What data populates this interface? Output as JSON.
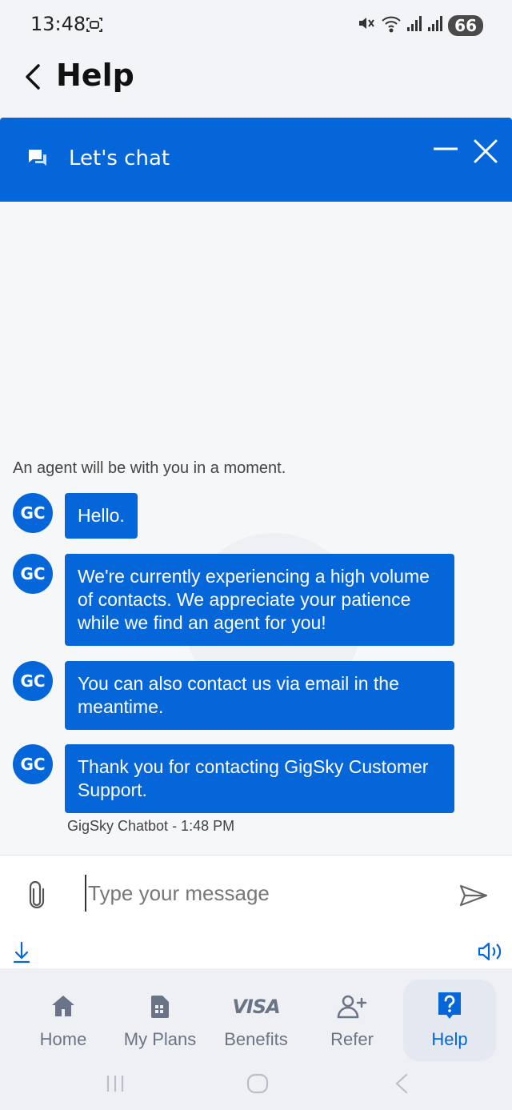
{
  "status_bar": {
    "time": "13:48",
    "battery": "66",
    "icons": [
      "screenshot-icon",
      "mute-icon",
      "wifi-icon",
      "signal-icon",
      "signal-icon"
    ]
  },
  "header": {
    "title": "Help",
    "back_icon": "chevron-left-icon"
  },
  "chat_widget": {
    "title": "Let's chat",
    "icons": [
      "chat-bubbles-icon",
      "minimize-icon",
      "close-icon"
    ],
    "accent_color": "#0466d9",
    "agent_note": "An agent will be with you in a moment.",
    "messages": [
      {
        "avatar": "GC",
        "text": "Hello."
      },
      {
        "avatar": "GC",
        "text": "We're currently experiencing a high volume of contacts. We appreciate your patience while we find an agent for you!"
      },
      {
        "avatar": "GC",
        "text": "You can also contact us via email in the meantime."
      },
      {
        "avatar": "GC",
        "text": "Thank you for contacting GigSky Customer Support."
      }
    ],
    "meta": "GigSky Chatbot - 1:48 PM",
    "composer": {
      "placeholder": "Type your message",
      "icons": [
        "paperclip-icon",
        "send-icon",
        "download-icon",
        "speaker-icon"
      ]
    }
  },
  "bottom_nav": {
    "items": [
      {
        "label": "Home",
        "icon": "home-icon",
        "active": false
      },
      {
        "label": "My Plans",
        "icon": "sim-card-icon",
        "active": false
      },
      {
        "label": "Benefits",
        "icon": "visa-icon",
        "icon_text": "VISA",
        "active": false
      },
      {
        "label": "Refer",
        "icon": "add-user-icon",
        "active": false
      },
      {
        "label": "Help",
        "icon": "help-icon",
        "active": true
      }
    ]
  },
  "system_nav": [
    "recent-apps-icon",
    "home-circle-icon",
    "back-icon"
  ]
}
